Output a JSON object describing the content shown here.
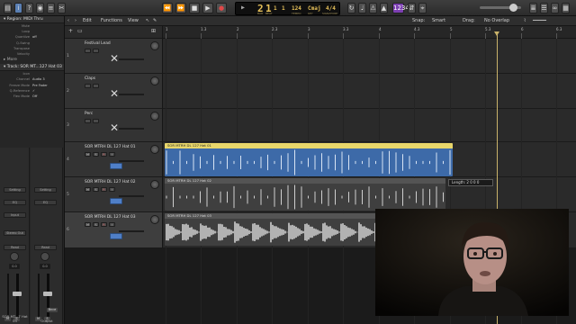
{
  "control_bar": {
    "transport": [
      "⏪",
      "⏩",
      "■",
      "▶",
      "●"
    ],
    "lcd": {
      "bar": "2",
      "beat": "1",
      "division": "1",
      "tick": "1",
      "tempo": "124",
      "key": "Cmaj",
      "signature": "4/4",
      "labels": {
        "bar": "BAR",
        "beat": "BEAT",
        "tempo": "TEMPO",
        "key": "KEY",
        "signature": "SIGNATURE"
      }
    },
    "badge": "1234"
  },
  "inspector": {
    "region_header": "▾ Region: MIDI Thru",
    "region_rows": [
      {
        "label": "Mute",
        "value": ""
      },
      {
        "label": "Loop",
        "value": ""
      },
      {
        "label": "Quantize",
        "value": "off"
      },
      {
        "label": "Q-Swing",
        "value": ""
      },
      {
        "label": "Transpose",
        "value": ""
      },
      {
        "label": "Velocity",
        "value": ""
      }
    ],
    "more": "▸ More",
    "track_header": "▾ Track: SOR MT...127 Hat 03",
    "track_rows": [
      {
        "label": "Icon",
        "value": ""
      },
      {
        "label": "Channel",
        "value": "Audio 3"
      },
      {
        "label": "Freeze Mode",
        "value": "Pre Fader"
      },
      {
        "label": "Q-Reference",
        "value": "✓"
      },
      {
        "label": "Flex Mode",
        "value": "Off"
      }
    ],
    "strips": [
      {
        "label": "SOR MT...7 Hat 03",
        "buttons": [
          "Setting",
          "EQ",
          "Input"
        ],
        "send": "Stereo Out",
        "read": "Read",
        "value": "0.0",
        "rs": [
          "M",
          "S"
        ]
      },
      {
        "label": "Output",
        "buttons": [
          "Setting",
          "EQ",
          ""
        ],
        "send": "",
        "read": "Read",
        "value": "0.0",
        "rs": [
          "M",
          "S"
        ],
        "bnce": "Bnce"
      }
    ]
  },
  "tracks_toolbar": {
    "edit": "Edit",
    "functions": "Functions",
    "view": "View",
    "snap_label": "Snap:",
    "snap_value": "Smart",
    "drag_label": "Drag:",
    "drag_value": "No Overlap"
  },
  "ruler": {
    "labels": [
      "1",
      "1.3",
      "2",
      "2.3",
      "3",
      "3.3",
      "4",
      "4.3",
      "5",
      "5.3",
      "6",
      "6.3"
    ]
  },
  "tracks": [
    {
      "num": "1",
      "name": "Festival Lead",
      "kind": "instrument"
    },
    {
      "num": "2",
      "name": "Claps",
      "kind": "instrument"
    },
    {
      "num": "3",
      "name": "Perc",
      "kind": "instrument"
    },
    {
      "num": "4",
      "name": "SOR MTRH DL 127 Hat 01",
      "kind": "audio",
      "btn_m": "M",
      "btn_s": "S",
      "btn_r": "R",
      "btn_i": "I"
    },
    {
      "num": "5",
      "name": "SOR MTRH DL 127 Hat 02",
      "kind": "audio",
      "btn_m": "M",
      "btn_s": "S",
      "btn_r": "R",
      "btn_i": "I"
    },
    {
      "num": "6",
      "name": "SOR MTRH DL 127 Hat 03",
      "kind": "audio",
      "btn_m": "M",
      "btn_s": "S",
      "btn_r": "R",
      "btn_i": "I"
    }
  ],
  "regions": [
    {
      "title": "SOR MTRH DL 127 Hat 01",
      "color": "#3d6aa8",
      "head_color": "#e8d66a"
    },
    {
      "title": "SOR MTRH DL 127 Hat 02",
      "color": "#3f3f3f",
      "head_color": "#545454"
    },
    {
      "title": "SOR MTRH DL 127 Hat 03",
      "color": "#3f3f3f",
      "head_color": "#545454"
    }
  ],
  "tooltip": "Length: 2 0 0 0",
  "colors": {
    "accent": "#e8c25a",
    "selected_region": "#3d6aa8"
  }
}
